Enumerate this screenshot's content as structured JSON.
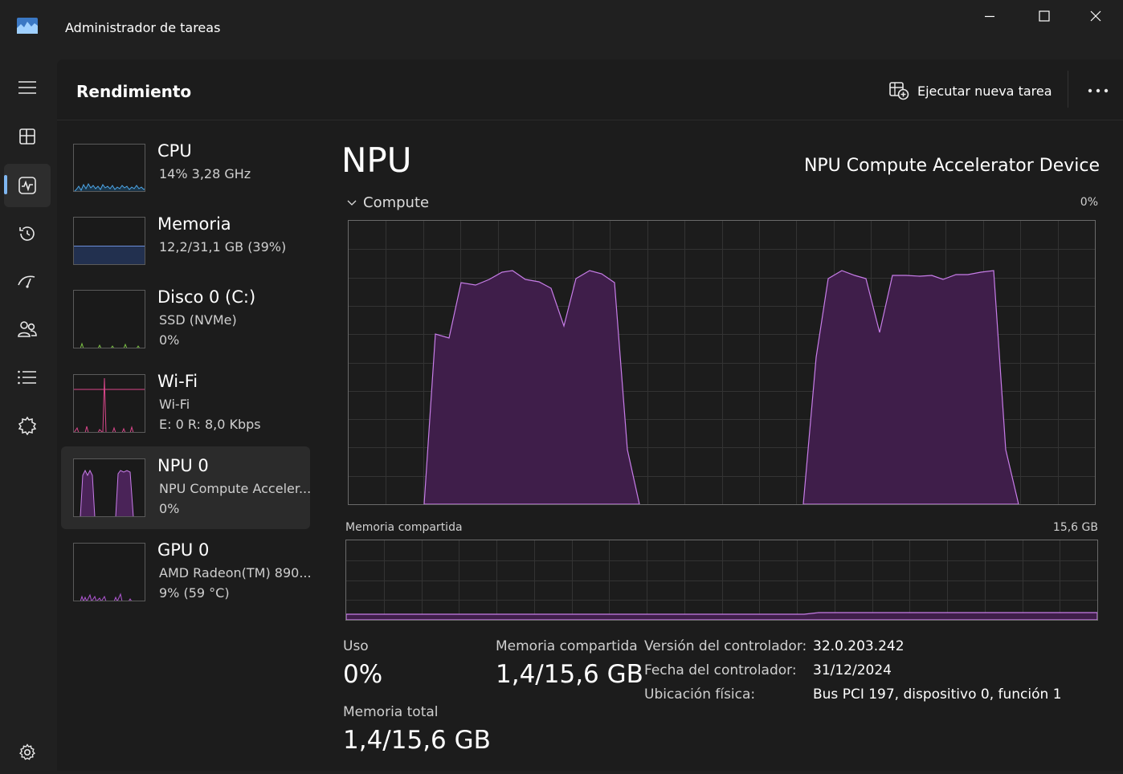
{
  "window": {
    "title": "Administrador de tareas",
    "controls": [
      "minimize-icon",
      "maximize-icon",
      "close-icon"
    ]
  },
  "nav": {
    "items": [
      {
        "icon": "hamburger-menu-icon"
      },
      {
        "icon": "processes-icon"
      },
      {
        "icon": "performance-icon",
        "active": true
      },
      {
        "icon": "app-history-icon"
      },
      {
        "icon": "startup-apps-icon"
      },
      {
        "icon": "users-icon"
      },
      {
        "icon": "details-icon"
      },
      {
        "icon": "services-icon"
      },
      {
        "icon": "settings-icon"
      }
    ]
  },
  "header": {
    "title": "Rendimiento",
    "run_task_label": "Ejecutar nueva tarea",
    "more_icon": "more-options-icon"
  },
  "devices": [
    {
      "name": "CPU",
      "line1": "14%  3,28 GHz",
      "line2": "",
      "color": "#4ea6e6"
    },
    {
      "name": "Memoria",
      "line1": "12,2/31,1 GB (39%)",
      "line2": "",
      "color": "#6a8ed8",
      "fill_level": 0.39
    },
    {
      "name": "Disco 0 (C:)",
      "line1": "SSD (NVMe)",
      "line2": "0%",
      "color": "#7bc043"
    },
    {
      "name": "Wi-Fi",
      "line1": "Wi-Fi",
      "line2": "E: 0  R: 8,0 Kbps",
      "color": "#d9468a"
    },
    {
      "name": "NPU 0",
      "line1": "NPU Compute Acceler...",
      "line2": "0%",
      "color": "#b258d6",
      "selected": true
    },
    {
      "name": "GPU 0",
      "line1": "AMD Radeon(TM) 890...",
      "line2": "9%  (59 °C)",
      "color": "#b258d6"
    }
  ],
  "detail": {
    "title": "NPU",
    "device_name": "NPU Compute Accelerator Device",
    "compute_label": "Compute",
    "compute_pct": "0%",
    "compute_series_color": "#c77de8",
    "compute_fill_color": "#3f1e4a",
    "shared_mem_label": "Memoria compartida",
    "shared_mem_max": "15,6 GB",
    "stats": {
      "uso_label": "Uso",
      "uso_value": "0%",
      "shared_label": "Memoria compartida",
      "shared_value": "1,4/15,6 GB",
      "total_label": "Memoria total",
      "total_value": "1,4/15,6 GB"
    },
    "info": [
      {
        "key": "Versión del controlador:",
        "value": "32.0.203.242"
      },
      {
        "key": "Fecha del controlador:",
        "value": "31/12/2024"
      },
      {
        "key": "Ubicación física:",
        "value": "Bus PCI 197, dispositivo 0, función 1"
      }
    ]
  }
}
